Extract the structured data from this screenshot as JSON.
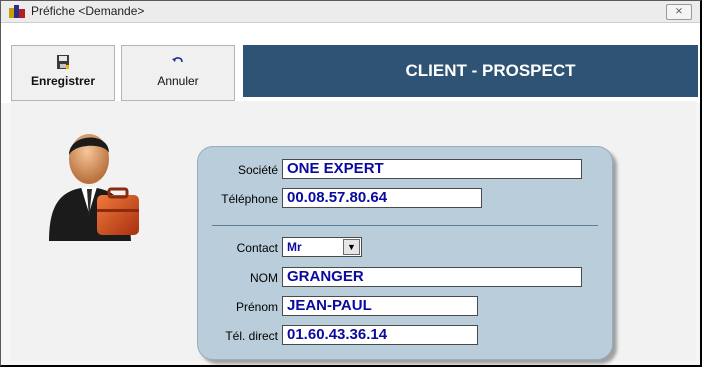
{
  "window": {
    "title": "Préfiche <Demande>",
    "close_glyph": "⨯"
  },
  "toolbar": {
    "save_label": "Enregistrer",
    "save_icon": "floppy-save-icon",
    "cancel_label": "Annuler",
    "cancel_icon": "undo-arrow-icon",
    "banner_title": "CLIENT - PROSPECT",
    "banner_color": "#2e5374"
  },
  "form": {
    "societe_label": "Société",
    "societe_value": "ONE EXPERT",
    "telephone_label": "Téléphone",
    "telephone_value": "00.08.57.80.64",
    "contact_label": "Contact",
    "contact_value": "Mr",
    "nom_label": "NOM",
    "nom_value": "GRANGER",
    "prenom_label": "Prénom",
    "prenom_value": "JEAN-PAUL",
    "tel_direct_label": "Tél. direct",
    "tel_direct_value": "01.60.43.36.14",
    "field_text_color": "#0b0aa0",
    "panel_color": "#b9cdda"
  }
}
